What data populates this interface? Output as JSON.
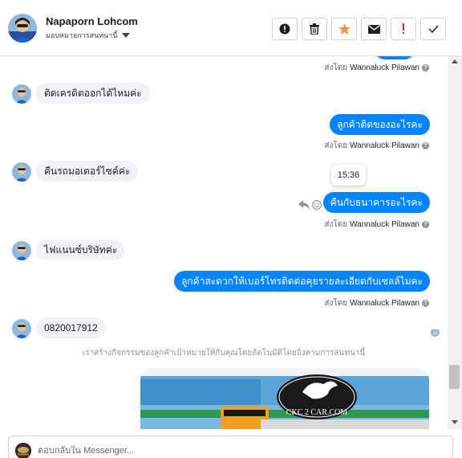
{
  "contact": {
    "name": "Napaporn Lohcom",
    "assignment_label": "มอบหมายการสนทนานี้"
  },
  "actions": [
    {
      "name": "alert-circle-icon",
      "color": "#1c1e21"
    },
    {
      "name": "trash-icon",
      "color": "#1c1e21"
    },
    {
      "name": "star-icon",
      "color": "#f7923b"
    },
    {
      "name": "envelope-icon",
      "color": "#1c1e21"
    },
    {
      "name": "exclamation-icon",
      "color": "#e02020"
    },
    {
      "name": "check-icon",
      "color": "#1c1e21"
    }
  ],
  "messages": [
    {
      "direction": "out",
      "text": "",
      "sent_by_prefix": "ส่งโดย",
      "sent_by_name": "Wannaluck Pilawan"
    },
    {
      "direction": "in",
      "text": "ติดเครดิตออกได้ไหมค่ะ"
    },
    {
      "direction": "out",
      "text": "ลูกค้าติดของอะไรคะ",
      "sent_by_prefix": "ส่งโดย",
      "sent_by_name": "Wannaluck Pilawan"
    },
    {
      "direction": "in",
      "text": "คืนรถมอเตอร์ไซค์ค่ะ"
    },
    {
      "direction": "out",
      "text": "คืนกับธนาคารอะไรคะ",
      "time_tooltip": "15:36",
      "sent_by_prefix": "ส่งโดย",
      "sent_by_name": "Wannaluck Pilawan"
    },
    {
      "direction": "in",
      "text": "ไฟแนนซ์บริษัทค่ะ"
    },
    {
      "direction": "out",
      "text": "ลูกค้าสะดวกให้เบอร์โทรติดต่อคุยรายละเอียดกับเซลล์ไมคะ",
      "sent_by_prefix": "ส่งโดย",
      "sent_by_name": "Wannaluck Pilawan"
    },
    {
      "direction": "in",
      "text": "0820017912"
    }
  ],
  "system_note": "เราสร้างกิจกรรมของลูกค้าเป้าหมายให้กับคุณโดยอัตโนมัติโดยอิงตามการสนทนานี้",
  "image_card": {
    "logo_text": "CKC 2 CAR.COM",
    "brand_colors": {
      "sky": "#5ba4d8",
      "building_green": "#2e9b4a",
      "sign_orange": "#f0a020"
    }
  },
  "composer": {
    "placeholder": "ตอบกลับใน Messenger..."
  },
  "colors": {
    "outgoing_bubble": "#0084ff",
    "incoming_bubble": "#f0f2f5",
    "border": "#dddfe2"
  }
}
